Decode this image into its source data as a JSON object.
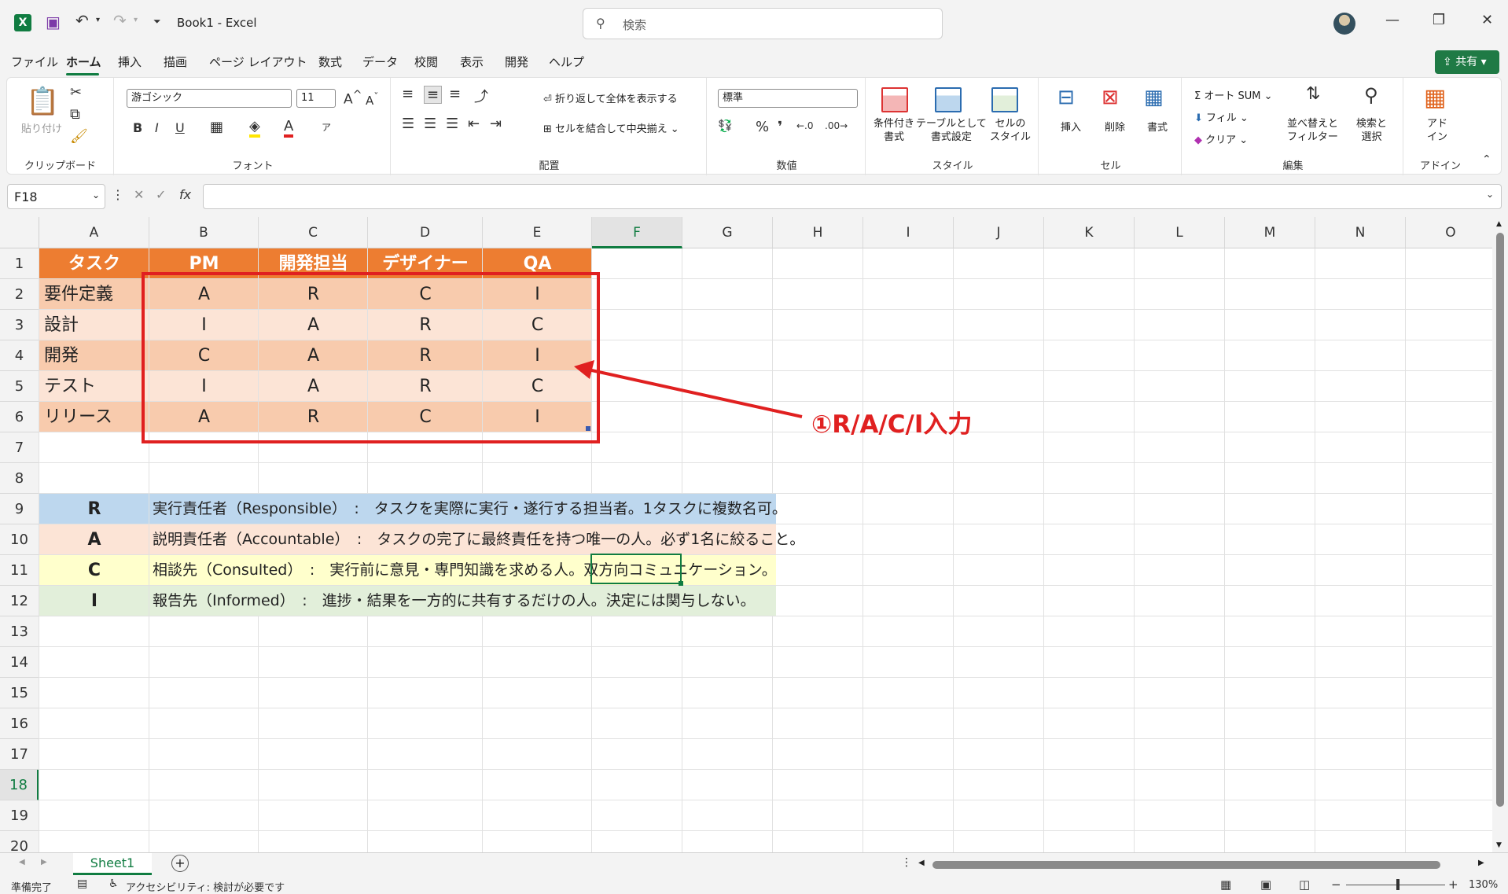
{
  "window": {
    "title": "Book1  -  Excel",
    "search_placeholder": "検索"
  },
  "menu": [
    "ファイル",
    "ホーム",
    "挿入",
    "描画",
    "ページ レイアウト",
    "数式",
    "データ",
    "校閲",
    "表示",
    "開発",
    "ヘルプ"
  ],
  "share_label": "共有",
  "ribbon": {
    "clipboard": {
      "paste": "貼り付け",
      "label": "クリップボード"
    },
    "font": {
      "name": "游ゴシック",
      "size": "11",
      "label": "フォント"
    },
    "alignment": {
      "wrap": "折り返して全体を表示する",
      "merge": "セルを結合して中央揃え",
      "label": "配置"
    },
    "number": {
      "format": "標準",
      "label": "数値"
    },
    "styles": {
      "conditional": "条件付き\n書式",
      "table": "テーブルとして\n書式設定",
      "cell": "セルの\nスタイル",
      "label": "スタイル"
    },
    "cells": {
      "insert": "挿入",
      "delete": "削除",
      "format": "書式",
      "label": "セル"
    },
    "editing": {
      "autosum": "オート SUM",
      "fill": "フィル",
      "clear": "クリア",
      "sort": "並べ替えと\nフィルター",
      "find": "検索と\n選択",
      "label": "編集"
    },
    "addins": {
      "addin": "アド\nイン",
      "label": "アドイン"
    }
  },
  "formula_bar": {
    "name_box": "F18",
    "fx": "fx",
    "value": ""
  },
  "columns": [
    "A",
    "B",
    "C",
    "D",
    "E",
    "F",
    "G",
    "H",
    "I",
    "J",
    "K",
    "L",
    "M",
    "N",
    "O"
  ],
  "rows": [
    "1",
    "2",
    "3",
    "4",
    "5",
    "6",
    "7",
    "8",
    "9",
    "10",
    "11",
    "12",
    "13",
    "14",
    "15",
    "16",
    "17",
    "18",
    "19",
    "20"
  ],
  "table": {
    "headers": [
      "タスク",
      "PM",
      "開発担当",
      "デザイナー",
      "QA"
    ],
    "rows": [
      [
        "要件定義",
        "A",
        "R",
        "C",
        "I"
      ],
      [
        "設計",
        "I",
        "A",
        "R",
        "C"
      ],
      [
        "開発",
        "C",
        "A",
        "R",
        "I"
      ],
      [
        "テスト",
        "I",
        "A",
        "R",
        "C"
      ],
      [
        "リリース",
        "A",
        "R",
        "C",
        "I"
      ]
    ]
  },
  "legend": [
    {
      "key": "R",
      "desc": "実行責任者（Responsible）　:　タスクを実際に実行・遂行する担当者。1タスクに複数名可。",
      "color": "#bdd7ee"
    },
    {
      "key": "A",
      "desc": "説明責任者（Accountable）　:　タスクの完了に最終責任を持つ唯一の人。必ず1名に絞ること。",
      "color": "#fce4d6"
    },
    {
      "key": "C",
      "desc": "相談先（Consulted）　:　実行前に意見・専門知識を求める人。双方向コミュニケーション。",
      "color": "#ffffcc"
    },
    {
      "key": "I",
      "desc": "報告先（Informed）　:　進捗・結果を一方的に共有するだけの人。決定には関与しない。",
      "color": "#e2efda"
    }
  ],
  "annotation": "①R/A/C/I入力",
  "colors": {
    "header": "#ed7d31",
    "row_dark": "#f8cbad",
    "row_light": "#fce4d6",
    "accent": "#107c41",
    "annotation": "#e02020"
  },
  "sheet_tab": "Sheet1",
  "status": {
    "ready": "準備完了",
    "accessibility": "アクセシビリティ: 検討が必要です",
    "zoom": "130%"
  }
}
